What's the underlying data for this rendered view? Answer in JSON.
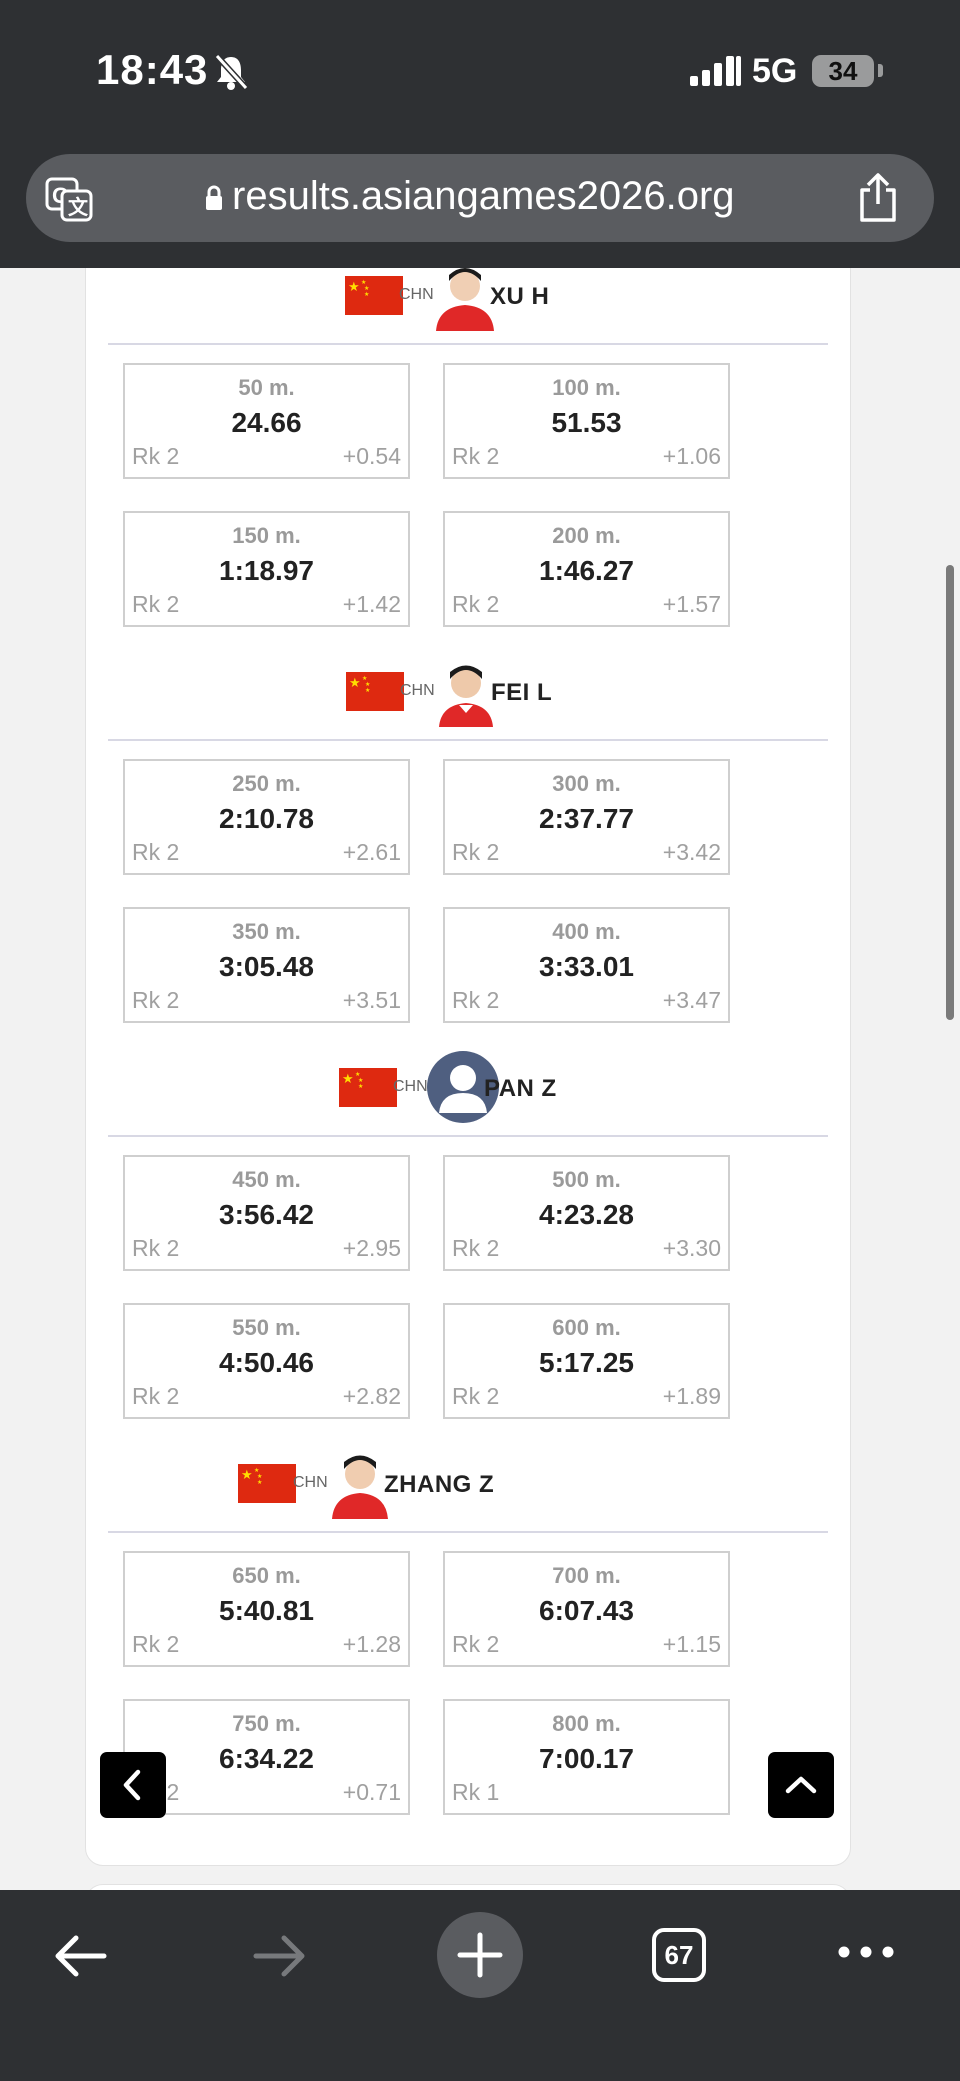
{
  "status_bar": {
    "time": "18:43",
    "network": "5G",
    "battery": "34"
  },
  "browser": {
    "url": "results.asiangames2026.org",
    "tab_count": "67"
  },
  "athletes": [
    {
      "noc": "CHN",
      "name": "XU H",
      "splits": [
        {
          "distance": "50 m.",
          "time": "24.66",
          "rank": "Rk 2",
          "gap": "+0.54"
        },
        {
          "distance": "100 m.",
          "time": "51.53",
          "rank": "Rk 2",
          "gap": "+1.06"
        },
        {
          "distance": "150 m.",
          "time": "1:18.97",
          "rank": "Rk 2",
          "gap": "+1.42"
        },
        {
          "distance": "200 m.",
          "time": "1:46.27",
          "rank": "Rk 2",
          "gap": "+1.57"
        }
      ]
    },
    {
      "noc": "CHN",
      "name": "FEI L",
      "splits": [
        {
          "distance": "250 m.",
          "time": "2:10.78",
          "rank": "Rk 2",
          "gap": "+2.61"
        },
        {
          "distance": "300 m.",
          "time": "2:37.77",
          "rank": "Rk 2",
          "gap": "+3.42"
        },
        {
          "distance": "350 m.",
          "time": "3:05.48",
          "rank": "Rk 2",
          "gap": "+3.51"
        },
        {
          "distance": "400 m.",
          "time": "3:33.01",
          "rank": "Rk 2",
          "gap": "+3.47"
        }
      ]
    },
    {
      "noc": "CHN",
      "name": "PAN Z",
      "splits": [
        {
          "distance": "450 m.",
          "time": "3:56.42",
          "rank": "Rk 2",
          "gap": "+2.95"
        },
        {
          "distance": "500 m.",
          "time": "4:23.28",
          "rank": "Rk 2",
          "gap": "+3.30"
        },
        {
          "distance": "550 m.",
          "time": "4:50.46",
          "rank": "Rk 2",
          "gap": "+2.82"
        },
        {
          "distance": "600 m.",
          "time": "5:17.25",
          "rank": "Rk 2",
          "gap": "+1.89"
        }
      ]
    },
    {
      "noc": "CHN",
      "name": "ZHANG Z",
      "splits": [
        {
          "distance": "650 m.",
          "time": "5:40.81",
          "rank": "Rk 2",
          "gap": "+1.28"
        },
        {
          "distance": "700 m.",
          "time": "6:07.43",
          "rank": "Rk 2",
          "gap": "+1.15"
        },
        {
          "distance": "750 m.",
          "time": "6:34.22",
          "rank": "Rk 2",
          "gap": "+0.71"
        },
        {
          "distance": "800 m.",
          "time": "7:00.17",
          "rank": "Rk 1",
          "gap": ""
        }
      ]
    }
  ]
}
